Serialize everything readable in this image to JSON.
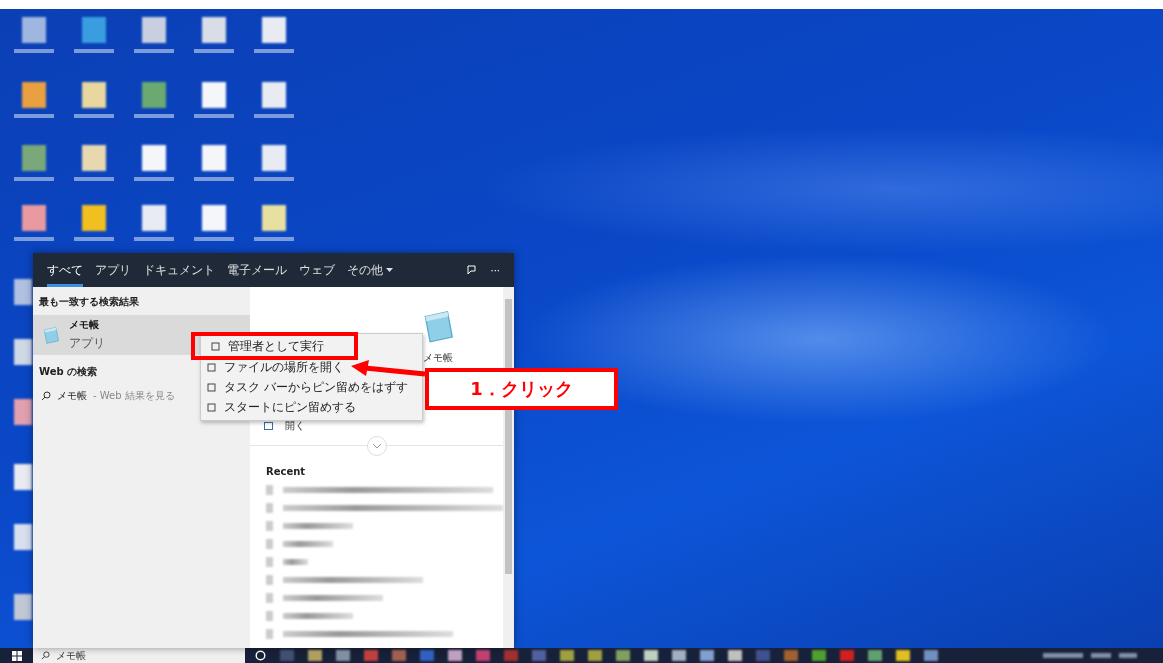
{
  "search_panel": {
    "tabs": [
      {
        "label": "すべて",
        "selected": true
      },
      {
        "label": "アプリ",
        "selected": false
      },
      {
        "label": "ドキュメント",
        "selected": false
      },
      {
        "label": "電子メール",
        "selected": false
      },
      {
        "label": "ウェブ",
        "selected": false
      },
      {
        "label": "その他",
        "selected": false,
        "kind": "dropdown"
      }
    ],
    "more_label": "···",
    "best_match": {
      "heading": "最も一致する検索結果",
      "app_name": "メモ帳",
      "app_type": "アプリ"
    },
    "web": {
      "heading": "Web の検索",
      "query": "メモ帳",
      "suffix": "- Web 結果を見る"
    },
    "preview": {
      "app_name": "メモ帳",
      "actions": [
        {
          "label": "開く"
        }
      ],
      "recent_heading": "Recent"
    }
  },
  "context_menu": [
    {
      "label": "管理者として実行",
      "highlighted": true
    },
    {
      "label": "ファイルの場所を開く",
      "highlighted": false
    },
    {
      "label": "タスク バーからピン留めをはずす",
      "highlighted": false
    },
    {
      "label": "スタートにピン留めする",
      "highlighted": false
    }
  ],
  "callout": {
    "label": "1．クリック"
  },
  "taskbar": {
    "search_text": "メモ帳"
  }
}
